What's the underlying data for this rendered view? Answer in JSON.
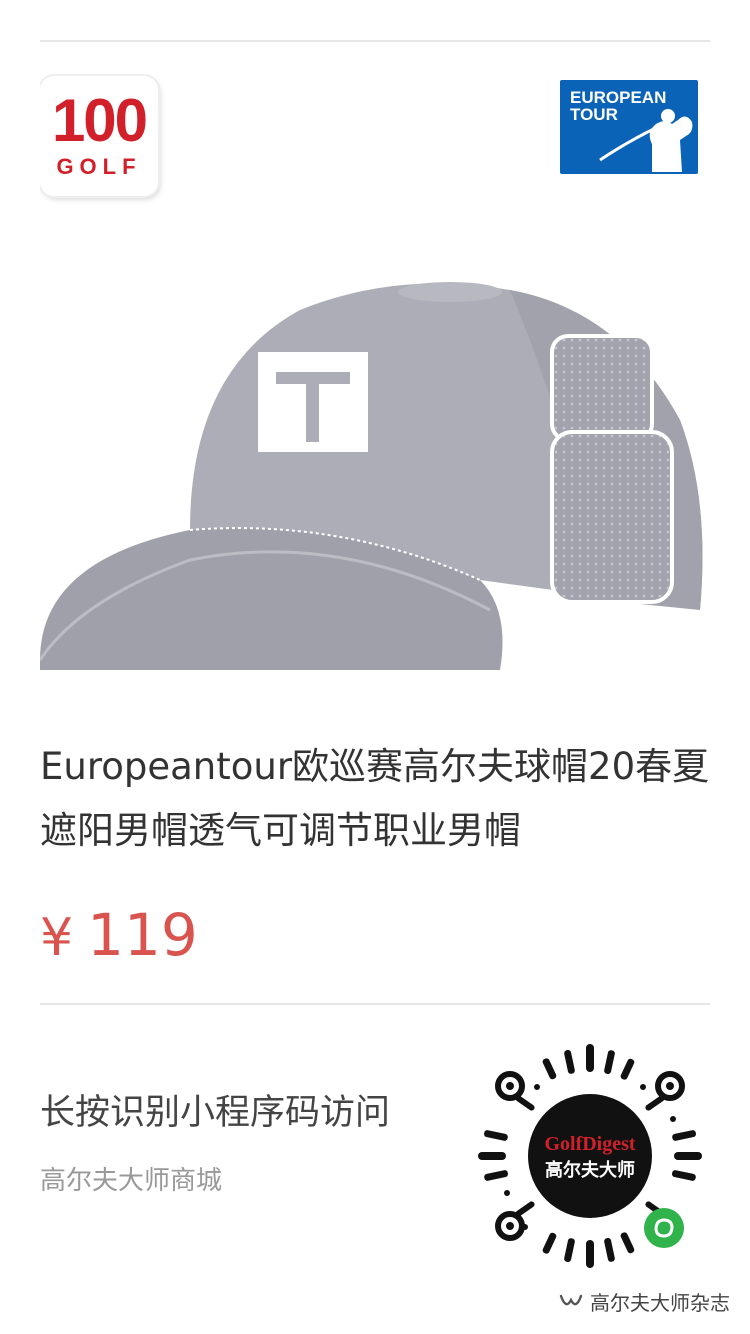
{
  "product": {
    "title": "Europeantour欧巡赛高尔夫球帽20春夏遮阳男帽透气可调节职业男帽",
    "currency_symbol": "¥",
    "price": "119"
  },
  "logos": {
    "left_number": "100",
    "left_word": "GOLF",
    "right_line1": "EUROPEAN",
    "right_line2": "TOUR"
  },
  "mini_program": {
    "hint": "长按识别小程序码访问",
    "shop_name": "高尔夫大师商城",
    "qr_brand_line1": "GolfDigest",
    "qr_brand_line2": "高尔夫大师"
  },
  "watermark": {
    "text": "高尔夫大师杂志"
  },
  "colors": {
    "price": "#d9534f",
    "brand_red": "#d2202b",
    "brand_blue": "#0a63b6",
    "cap": "#a9a9b3"
  },
  "icons": {
    "logo_left": "100-golf-logo",
    "logo_right": "european-tour-logo",
    "qr": "mini-program-code",
    "watermark": "wechat-channel-icon"
  }
}
